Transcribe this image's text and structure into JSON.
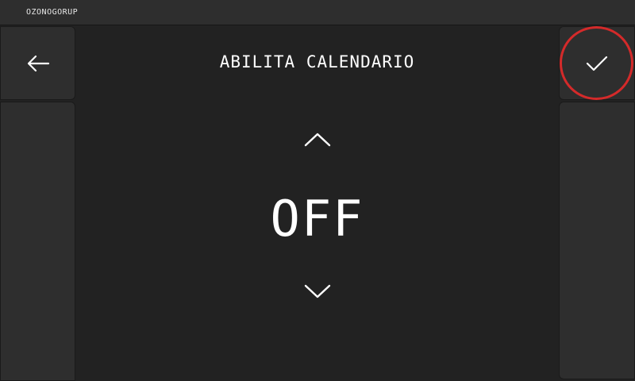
{
  "header": {
    "brand": "OZONOGORUP"
  },
  "screen": {
    "title": "ABILITA CALENDARIO",
    "value": "OFF"
  },
  "icons": {
    "back": "arrow-left-icon",
    "confirm": "check-icon",
    "increase": "chevron-up-icon",
    "decrease": "chevron-down-icon"
  },
  "colors": {
    "background": "#222222",
    "panel": "#2e2e2e",
    "text": "#ffffff",
    "highlight": "#d42a2a"
  }
}
